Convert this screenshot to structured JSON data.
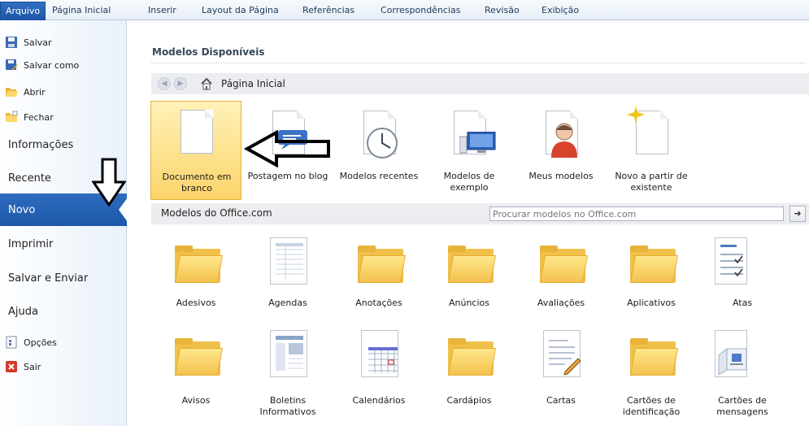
{
  "tabs": [
    "Arquivo",
    "Página Inicial",
    "Inserir",
    "Layout da Página",
    "Referências",
    "Correspondências",
    "Revisão",
    "Exibição"
  ],
  "nav": {
    "save": "Salvar",
    "save_as": "Salvar como",
    "open": "Abrir",
    "close": "Fechar",
    "info": "Informações",
    "recent": "Recente",
    "new": "Novo",
    "print": "Imprimir",
    "save_send": "Salvar e Enviar",
    "help": "Ajuda",
    "options": "Opções",
    "exit": "Sair"
  },
  "main": {
    "section_title": "Modelos Disponíveis",
    "breadcrumb": "Página Inicial",
    "templates": [
      "Documento em branco",
      "Postagem no blog",
      "Modelos recentes",
      "Modelos de exemplo",
      "Meus modelos",
      "Novo a partir de existente"
    ],
    "office_title": "Modelos do Office.com",
    "search_placeholder": "Procurar modelos no Office.com",
    "search_go": "➜",
    "categories": [
      "Adesivos",
      "Agendas",
      "Anotações",
      "Anúncios",
      "Avaliações",
      "Aplicativos",
      "Atas",
      "Avisos",
      "Boletins Informativos",
      "Calendários",
      "Cardápios",
      "Cartas",
      "Cartões de identificação",
      "Cartões de mensagens"
    ]
  },
  "colors": {
    "accent": "#1f5aaa",
    "selected_tile": "#fbd46a",
    "folder": "#f4c24f"
  }
}
